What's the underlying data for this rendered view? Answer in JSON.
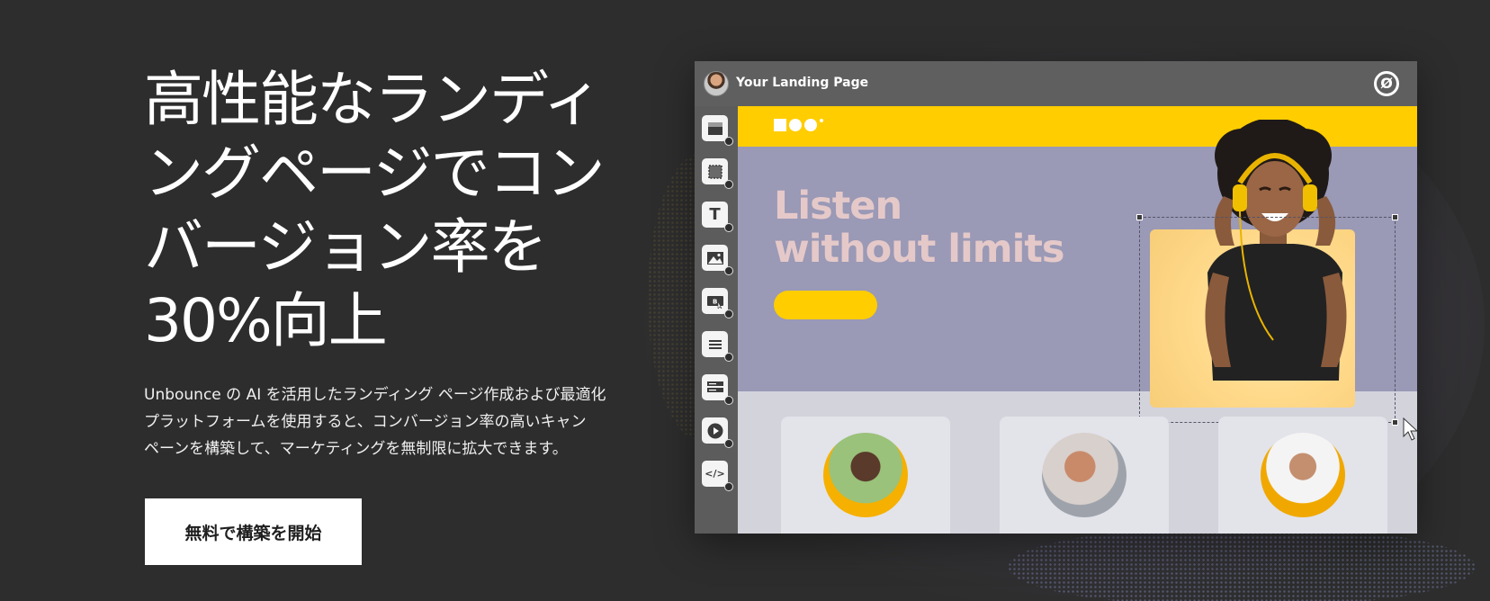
{
  "hero": {
    "title": "高性能なランディ\nングページでコン\nバージョン率を\n30%向上",
    "description": "Unbounce の AI を活用したランディング ページ作成および最適化\nプラットフォームを使用すると、コンバージョン率の高いキャン\nペーンを構築して、マーケティングを無制限に拡大できます。",
    "cta_label": "無料で構築を開始"
  },
  "editor": {
    "topbar": {
      "title": "Your Landing Page",
      "avatar_icon": "user-avatar",
      "logo_icon": "unbounce-logo-icon"
    },
    "tools": [
      {
        "name": "section-tool-icon"
      },
      {
        "name": "box-tool-icon"
      },
      {
        "name": "text-tool-icon",
        "glyph": "T"
      },
      {
        "name": "image-tool-icon"
      },
      {
        "name": "button-tool-icon"
      },
      {
        "name": "form-tool-icon"
      },
      {
        "name": "list-tool-icon"
      },
      {
        "name": "video-tool-icon"
      },
      {
        "name": "code-tool-icon",
        "glyph": "</>"
      }
    ],
    "canvas": {
      "headline": "Listen\nwithout limits",
      "brand_color": "#ffcd00",
      "band_color": "#9a99b6"
    }
  },
  "colors": {
    "background": "#2d2d2d",
    "accent": "#ffcd00"
  }
}
